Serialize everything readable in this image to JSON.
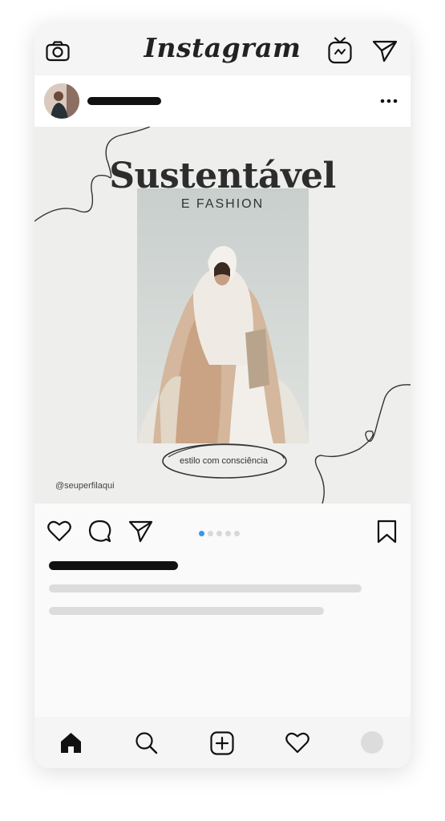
{
  "app": {
    "title": "Instagram"
  },
  "top_icons": [
    "camera-icon",
    "igtv-icon",
    "direct-message-icon"
  ],
  "post": {
    "title": "Sustentável",
    "subtitle": "E FASHION",
    "tagline": "estilo com consciência",
    "handle": "@seuperfilaqui",
    "carousel": {
      "total": 5,
      "current": 1
    }
  },
  "action_icons": [
    "like-icon",
    "comment-icon",
    "share-icon",
    "bookmark-icon"
  ],
  "bottom_nav": [
    "home-icon",
    "search-icon",
    "add-post-icon",
    "activity-icon",
    "profile-avatar"
  ],
  "colors": {
    "accent": "#3797f0",
    "text": "#2d2d2d",
    "placeholder": "#dcdcdc"
  }
}
